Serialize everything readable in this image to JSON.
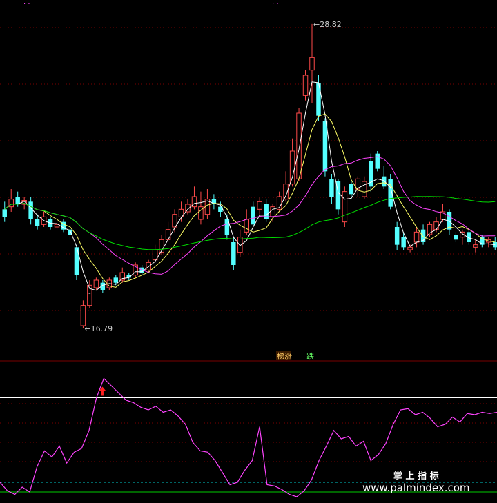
{
  "colors": {
    "background": "#000000",
    "grid": "#7a0000",
    "up_candle": "#ff4a4a",
    "down_candle": "#54ffff",
    "ma_short": "#ffffff",
    "ma_mid": "#ffff66",
    "ma_long": "#ff44ff",
    "ma_longer": "#00dd00",
    "osc": "#ff44ff",
    "line_upper": "#ffffff",
    "line_mid": "#00c8c8",
    "line_lower": "#00cc00",
    "arrow": "#ff2020"
  },
  "price_panel": {
    "high_marker": "28.82",
    "low_marker": "16.79",
    "marker_arrow": "←"
  },
  "signal_labels": {
    "rise": "梯涨",
    "fall": "跌"
  },
  "watermark": {
    "line1": "掌 上 指 标",
    "line2": "www.palmindex.com"
  },
  "chart_data": {
    "type": "candlestick",
    "price_range": [
      16.0,
      29.5
    ],
    "candles": [
      {
        "o": 21.2,
        "c": 21.5,
        "h": 21.8,
        "l": 21.0,
        "dir": "down"
      },
      {
        "o": 21.6,
        "c": 21.9,
        "h": 22.3,
        "l": 21.4,
        "dir": "up"
      },
      {
        "o": 22.0,
        "c": 21.7,
        "h": 22.2,
        "l": 21.6,
        "dir": "down"
      },
      {
        "o": 21.7,
        "c": 21.85,
        "h": 22.0,
        "l": 21.5,
        "dir": "up"
      },
      {
        "o": 21.8,
        "c": 21.1,
        "h": 22.0,
        "l": 20.9,
        "dir": "down"
      },
      {
        "o": 21.1,
        "c": 20.85,
        "h": 21.3,
        "l": 20.7,
        "dir": "down"
      },
      {
        "o": 20.9,
        "c": 21.2,
        "h": 21.4,
        "l": 20.8,
        "dir": "up"
      },
      {
        "o": 21.1,
        "c": 20.8,
        "h": 21.2,
        "l": 20.7,
        "dir": "down"
      },
      {
        "o": 20.9,
        "c": 20.8,
        "h": 21.1,
        "l": 20.7,
        "dir": "up"
      },
      {
        "o": 21.0,
        "c": 20.7,
        "h": 21.1,
        "l": 20.6,
        "dir": "down"
      },
      {
        "o": 20.7,
        "c": 20.5,
        "h": 20.9,
        "l": 20.3,
        "dir": "down"
      },
      {
        "o": 20.0,
        "c": 18.9,
        "h": 20.1,
        "l": 18.7,
        "dir": "down"
      },
      {
        "o": 16.9,
        "c": 17.7,
        "h": 17.9,
        "l": 16.79,
        "dir": "up"
      },
      {
        "o": 17.7,
        "c": 18.5,
        "h": 18.7,
        "l": 17.6,
        "dir": "up"
      },
      {
        "o": 18.4,
        "c": 18.7,
        "h": 18.8,
        "l": 18.3,
        "dir": "up"
      },
      {
        "o": 18.6,
        "c": 18.3,
        "h": 18.7,
        "l": 18.2,
        "dir": "down"
      },
      {
        "o": 18.4,
        "c": 18.7,
        "h": 18.8,
        "l": 18.3,
        "dir": "up"
      },
      {
        "o": 18.8,
        "c": 18.6,
        "h": 18.9,
        "l": 18.5,
        "dir": "down"
      },
      {
        "o": 18.7,
        "c": 19.0,
        "h": 19.2,
        "l": 18.6,
        "dir": "up"
      },
      {
        "o": 18.9,
        "c": 18.8,
        "h": 19.0,
        "l": 18.7,
        "dir": "down"
      },
      {
        "o": 18.9,
        "c": 19.3,
        "h": 19.4,
        "l": 18.8,
        "dir": "up"
      },
      {
        "o": 19.2,
        "c": 19.0,
        "h": 19.3,
        "l": 18.9,
        "dir": "down"
      },
      {
        "o": 19.1,
        "c": 19.4,
        "h": 19.5,
        "l": 19.0,
        "dir": "up"
      },
      {
        "o": 19.5,
        "c": 19.9,
        "h": 20.1,
        "l": 19.4,
        "dir": "up"
      },
      {
        "o": 19.8,
        "c": 20.3,
        "h": 20.5,
        "l": 19.7,
        "dir": "up"
      },
      {
        "o": 20.3,
        "c": 20.7,
        "h": 21.0,
        "l": 20.2,
        "dir": "up"
      },
      {
        "o": 20.8,
        "c": 21.3,
        "h": 21.5,
        "l": 20.6,
        "dir": "up"
      },
      {
        "o": 21.2,
        "c": 21.5,
        "h": 21.8,
        "l": 21.0,
        "dir": "up"
      },
      {
        "o": 21.4,
        "c": 21.7,
        "h": 21.9,
        "l": 21.3,
        "dir": "up"
      },
      {
        "o": 21.6,
        "c": 22.0,
        "h": 22.4,
        "l": 21.5,
        "dir": "up"
      },
      {
        "o": 21.1,
        "c": 21.6,
        "h": 22.2,
        "l": 20.9,
        "dir": "up"
      },
      {
        "o": 21.3,
        "c": 21.9,
        "h": 22.3,
        "l": 21.1,
        "dir": "up"
      },
      {
        "o": 21.9,
        "c": 21.7,
        "h": 22.1,
        "l": 21.5,
        "dir": "down"
      },
      {
        "o": 21.6,
        "c": 21.4,
        "h": 21.8,
        "l": 21.2,
        "dir": "down"
      },
      {
        "o": 21.1,
        "c": 20.5,
        "h": 21.3,
        "l": 20.3,
        "dir": "down"
      },
      {
        "o": 20.2,
        "c": 19.3,
        "h": 20.4,
        "l": 19.1,
        "dir": "down"
      },
      {
        "o": 19.8,
        "c": 20.4,
        "h": 20.7,
        "l": 19.6,
        "dir": "up"
      },
      {
        "o": 20.6,
        "c": 21.1,
        "h": 21.5,
        "l": 20.5,
        "dir": "up"
      },
      {
        "o": 21.6,
        "c": 20.9,
        "h": 21.8,
        "l": 20.8,
        "dir": "down"
      },
      {
        "o": 21.5,
        "c": 21.8,
        "h": 22.0,
        "l": 21.3,
        "dir": "up"
      },
      {
        "o": 21.7,
        "c": 21.1,
        "h": 21.9,
        "l": 21.0,
        "dir": "down"
      },
      {
        "o": 21.2,
        "c": 21.6,
        "h": 21.7,
        "l": 21.0,
        "dir": "up"
      },
      {
        "o": 21.5,
        "c": 22.0,
        "h": 22.2,
        "l": 21.4,
        "dir": "up"
      },
      {
        "o": 21.9,
        "c": 22.5,
        "h": 23.0,
        "l": 21.8,
        "dir": "up"
      },
      {
        "o": 22.5,
        "c": 23.8,
        "h": 24.3,
        "l": 22.4,
        "dir": "up"
      },
      {
        "o": 22.7,
        "c": 25.3,
        "h": 25.5,
        "l": 22.6,
        "dir": "up"
      },
      {
        "o": 26.0,
        "c": 26.8,
        "h": 27.0,
        "l": 25.8,
        "dir": "up"
      },
      {
        "o": 27.0,
        "c": 27.5,
        "h": 28.82,
        "l": 25.7,
        "dir": "up"
      },
      {
        "o": 26.5,
        "c": 25.2,
        "h": 26.8,
        "l": 25.0,
        "dir": "down"
      },
      {
        "o": 25.0,
        "c": 23.0,
        "h": 25.1,
        "l": 22.8,
        "dir": "down"
      },
      {
        "o": 22.7,
        "c": 22.0,
        "h": 22.9,
        "l": 21.7,
        "dir": "down"
      },
      {
        "o": 22.6,
        "c": 21.5,
        "h": 22.7,
        "l": 21.3,
        "dir": "down"
      },
      {
        "o": 21.0,
        "c": 22.2,
        "h": 22.4,
        "l": 20.8,
        "dir": "up"
      },
      {
        "o": 22.5,
        "c": 22.1,
        "h": 22.7,
        "l": 21.9,
        "dir": "down"
      },
      {
        "o": 22.3,
        "c": 22.7,
        "h": 22.8,
        "l": 22.0,
        "dir": "up"
      },
      {
        "o": 22.0,
        "c": 22.6,
        "h": 22.8,
        "l": 21.9,
        "dir": "up"
      },
      {
        "o": 23.4,
        "c": 22.4,
        "h": 23.7,
        "l": 22.2,
        "dir": "down"
      },
      {
        "o": 23.7,
        "c": 23.1,
        "h": 23.8,
        "l": 23.0,
        "dir": "down"
      },
      {
        "o": 22.8,
        "c": 22.4,
        "h": 23.2,
        "l": 22.3,
        "dir": "down"
      },
      {
        "o": 22.7,
        "c": 21.6,
        "h": 22.9,
        "l": 21.5,
        "dir": "down"
      },
      {
        "o": 20.8,
        "c": 20.1,
        "h": 21.0,
        "l": 19.9,
        "dir": "down"
      },
      {
        "o": 20.4,
        "c": 20.0,
        "h": 20.6,
        "l": 19.9,
        "dir": "down"
      },
      {
        "o": 19.9,
        "c": 20.0,
        "h": 20.1,
        "l": 19.8,
        "dir": "up"
      },
      {
        "o": 20.2,
        "c": 20.6,
        "h": 20.8,
        "l": 20.0,
        "dir": "up"
      },
      {
        "o": 20.7,
        "c": 20.2,
        "h": 20.9,
        "l": 20.1,
        "dir": "down"
      },
      {
        "o": 20.5,
        "c": 20.9,
        "h": 21.0,
        "l": 20.4,
        "dir": "up"
      },
      {
        "o": 20.7,
        "c": 21.0,
        "h": 21.2,
        "l": 20.6,
        "dir": "up"
      },
      {
        "o": 21.1,
        "c": 21.4,
        "h": 21.7,
        "l": 21.0,
        "dir": "up"
      },
      {
        "o": 21.4,
        "c": 20.7,
        "h": 21.5,
        "l": 20.5,
        "dir": "down"
      },
      {
        "o": 20.5,
        "c": 20.3,
        "h": 20.6,
        "l": 20.2,
        "dir": "down"
      },
      {
        "o": 20.4,
        "c": 20.6,
        "h": 20.7,
        "l": 20.1,
        "dir": "up"
      },
      {
        "o": 20.6,
        "c": 20.2,
        "h": 20.7,
        "l": 20.1,
        "dir": "down"
      },
      {
        "o": 20.0,
        "c": 20.1,
        "h": 20.3,
        "l": 19.8,
        "dir": "up"
      },
      {
        "o": 20.4,
        "c": 20.1,
        "h": 20.5,
        "l": 20.0,
        "dir": "down"
      },
      {
        "o": 20.3,
        "c": 20.2,
        "h": 20.4,
        "l": 20.0,
        "dir": "up"
      },
      {
        "o": 20.2,
        "c": 20.0,
        "h": 20.4,
        "l": 19.9,
        "dir": "down"
      }
    ],
    "osc_range": [
      0,
      100
    ],
    "osc_values": [
      12,
      5,
      2,
      8,
      4,
      25,
      38,
      33,
      42,
      28,
      37,
      40,
      55,
      82,
      98,
      92,
      86,
      80,
      78,
      74,
      72,
      75,
      70,
      72,
      67,
      60,
      45,
      38,
      37,
      30,
      20,
      10,
      12,
      22,
      30,
      58,
      10,
      9,
      6,
      2,
      0,
      5,
      14,
      30,
      42,
      55,
      48,
      50,
      42,
      46,
      30,
      35,
      44,
      60,
      72,
      73,
      68,
      70,
      65,
      58,
      60,
      66,
      62,
      69,
      68,
      70,
      69,
      70
    ],
    "osc_lines": [
      {
        "name": "upper",
        "value": 82
      },
      {
        "name": "mid",
        "value": 12
      },
      {
        "name": "lower",
        "value": 4
      }
    ]
  }
}
